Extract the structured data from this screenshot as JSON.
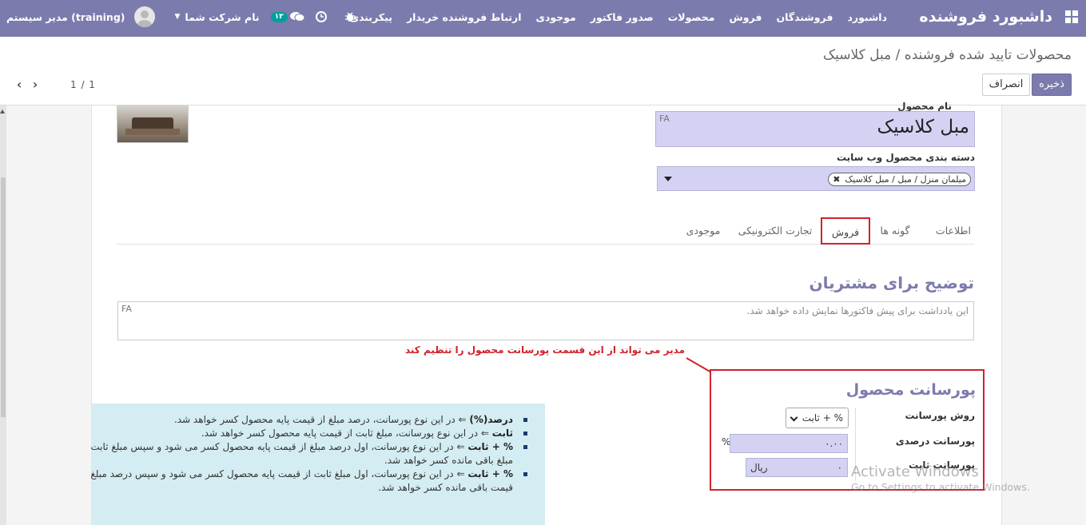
{
  "navbar": {
    "brand": "داشبورد فروشنده",
    "menu": [
      "داشبورد",
      "فروشندگان",
      "فروش",
      "محصولات",
      "صدور فاکتور",
      "موجودی",
      "ارتباط فروشنده خریدار",
      "پیکربندی"
    ],
    "message_count": "۱۳",
    "company_label": "نام شرکت شما",
    "user_name": "مدیر سیستم (training)"
  },
  "control_panel": {
    "breadcrumb": "محصولات تایید شده فروشنده / مبل کلاسیک",
    "save_label": "ذخیره",
    "discard_label": "انصراف",
    "pager_value": "1 / 1"
  },
  "form": {
    "name_label": "نام محصول",
    "name_value": "مبل کلاسیک",
    "lang_tag": "FA",
    "category_label": "دسته بندی محصول وب سایت",
    "category_tag": "میلمان منزل / مبل / مبل کلاسیک",
    "tabs": [
      "اطلاعات",
      "گونه ها",
      "فروش",
      "تجارت الکترونیکی",
      "موجودی"
    ],
    "active_tab": "فروش",
    "description_title": "توضیح برای مشتریان",
    "description_placeholder": "این یادداشت برای پیش فاکتورها نمایش داده خواهد شد."
  },
  "annotation": "مدیر می تواند از این قسمت پورسانت محصول را تنظیم کند",
  "commission": {
    "title": "پورسانت محصول",
    "method_label": "روش پورسانت",
    "method_value": "% + ثابت",
    "percent_label": "پورسانت درصدی",
    "percent_value": "۰.۰۰",
    "percent_sign": "%",
    "fixed_label": "پورسانت ثابت",
    "fixed_value": "۰",
    "fixed_currency": "ریال"
  },
  "help": [
    {
      "term": "درصد(%)",
      "text": "⇐ در این نوع پورسانت، درصد مبلغ از قیمت پایه محصول کسر خواهد شد.",
      "cont": ""
    },
    {
      "term": "ثابت",
      "text": "⇐ در این نوع پورسانت، مبلغ ثابت از قیمت پایه محصول کسر خواهد شد.",
      "cont": ""
    },
    {
      "term": "% + ثابت",
      "text": "⇐ در این نوع پورسانت، اول درصد مبلغ از قیمت پایه محصول کسر می شود و سپس مبلغ ثابت",
      "cont": "مبلغ باقی مانده کسر خواهد شد."
    },
    {
      "term": "% + ثابت",
      "text": "⇐ در این نوع پورسانت، اول مبلغ ثابت از قیمت پایه محصول کسر می شود و سپس درصد مبلغ",
      "cont": "قیمت باقی مانده کسر خواهد شد."
    }
  ],
  "watermark": {
    "line1": "Activate Windows",
    "line2": "Go to Settings to activate Windows."
  }
}
